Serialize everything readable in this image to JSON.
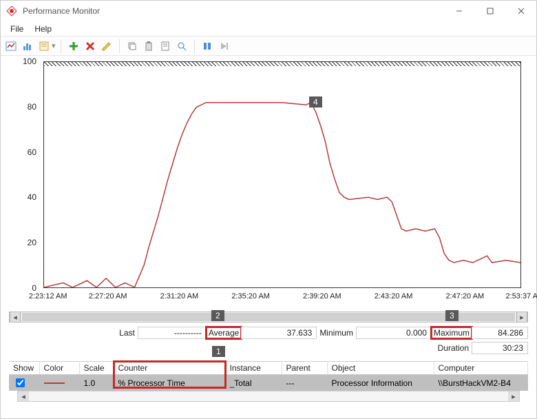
{
  "window": {
    "title": "Performance Monitor"
  },
  "menu": {
    "file": "File",
    "help": "Help"
  },
  "chart_data": {
    "type": "line",
    "title": "",
    "xlabel": "",
    "ylabel": "",
    "ylim": [
      0,
      100
    ],
    "y_ticks": [
      0,
      20,
      40,
      60,
      80,
      100
    ],
    "x_ticks": [
      "2:23:12 AM",
      "2:27:20 AM",
      "2:31:20 AM",
      "2:35:20 AM",
      "2:39:20 AM",
      "2:43:20 AM",
      "2:47:20 AM",
      "2:53:37 AM"
    ],
    "series": [
      {
        "name": "% Processor Time",
        "color": "#b33939",
        "points": [
          [
            0,
            0
          ],
          [
            4,
            2
          ],
          [
            6,
            0
          ],
          [
            9,
            3
          ],
          [
            11,
            0
          ],
          [
            13,
            4
          ],
          [
            15,
            0
          ],
          [
            17,
            2
          ],
          [
            19,
            0
          ],
          [
            20,
            5
          ],
          [
            21,
            10
          ],
          [
            22,
            18
          ],
          [
            23,
            25
          ],
          [
            24,
            32
          ],
          [
            25,
            40
          ],
          [
            26,
            48
          ],
          [
            27,
            55
          ],
          [
            28,
            62
          ],
          [
            29,
            68
          ],
          [
            30,
            73
          ],
          [
            31,
            77
          ],
          [
            32,
            80
          ],
          [
            33,
            81
          ],
          [
            34,
            82
          ],
          [
            40,
            82
          ],
          [
            45,
            82
          ],
          [
            50,
            82
          ],
          [
            55,
            81
          ],
          [
            56,
            82
          ],
          [
            57,
            78
          ],
          [
            58,
            72
          ],
          [
            59,
            65
          ],
          [
            60,
            55
          ],
          [
            61,
            48
          ],
          [
            62,
            42
          ],
          [
            63,
            40
          ],
          [
            64,
            39
          ],
          [
            68,
            40
          ],
          [
            70,
            39
          ],
          [
            72,
            40
          ],
          [
            73,
            38
          ],
          [
            74,
            32
          ],
          [
            75,
            26
          ],
          [
            76,
            25
          ],
          [
            78,
            26
          ],
          [
            80,
            25
          ],
          [
            82,
            26
          ],
          [
            83,
            22
          ],
          [
            84,
            15
          ],
          [
            85,
            12
          ],
          [
            86,
            11
          ],
          [
            88,
            12
          ],
          [
            90,
            11
          ],
          [
            93,
            14
          ],
          [
            94,
            11
          ],
          [
            97,
            12
          ],
          [
            100,
            11
          ]
        ]
      }
    ]
  },
  "stats": {
    "labels": {
      "last": "Last",
      "average": "Average",
      "minimum": "Minimum",
      "maximum": "Maximum",
      "duration": "Duration"
    },
    "values": {
      "last": "----------",
      "average": "37.633",
      "minimum": "0.000",
      "maximum": "84.286",
      "duration": "30:23"
    }
  },
  "grid": {
    "headers": [
      "Show",
      "Color",
      "Scale",
      "Counter",
      "Instance",
      "Parent",
      "Object",
      "Computer"
    ],
    "rows": [
      {
        "show": true,
        "color": "#c33",
        "scale": "1.0",
        "counter": "% Processor Time",
        "instance": "_Total",
        "parent": "---",
        "object": "Processor Information",
        "computer": "\\\\BurstHackVM2-B4"
      }
    ]
  },
  "annotations": [
    {
      "label": "1"
    },
    {
      "label": "2"
    },
    {
      "label": "3"
    },
    {
      "label": "4"
    }
  ]
}
